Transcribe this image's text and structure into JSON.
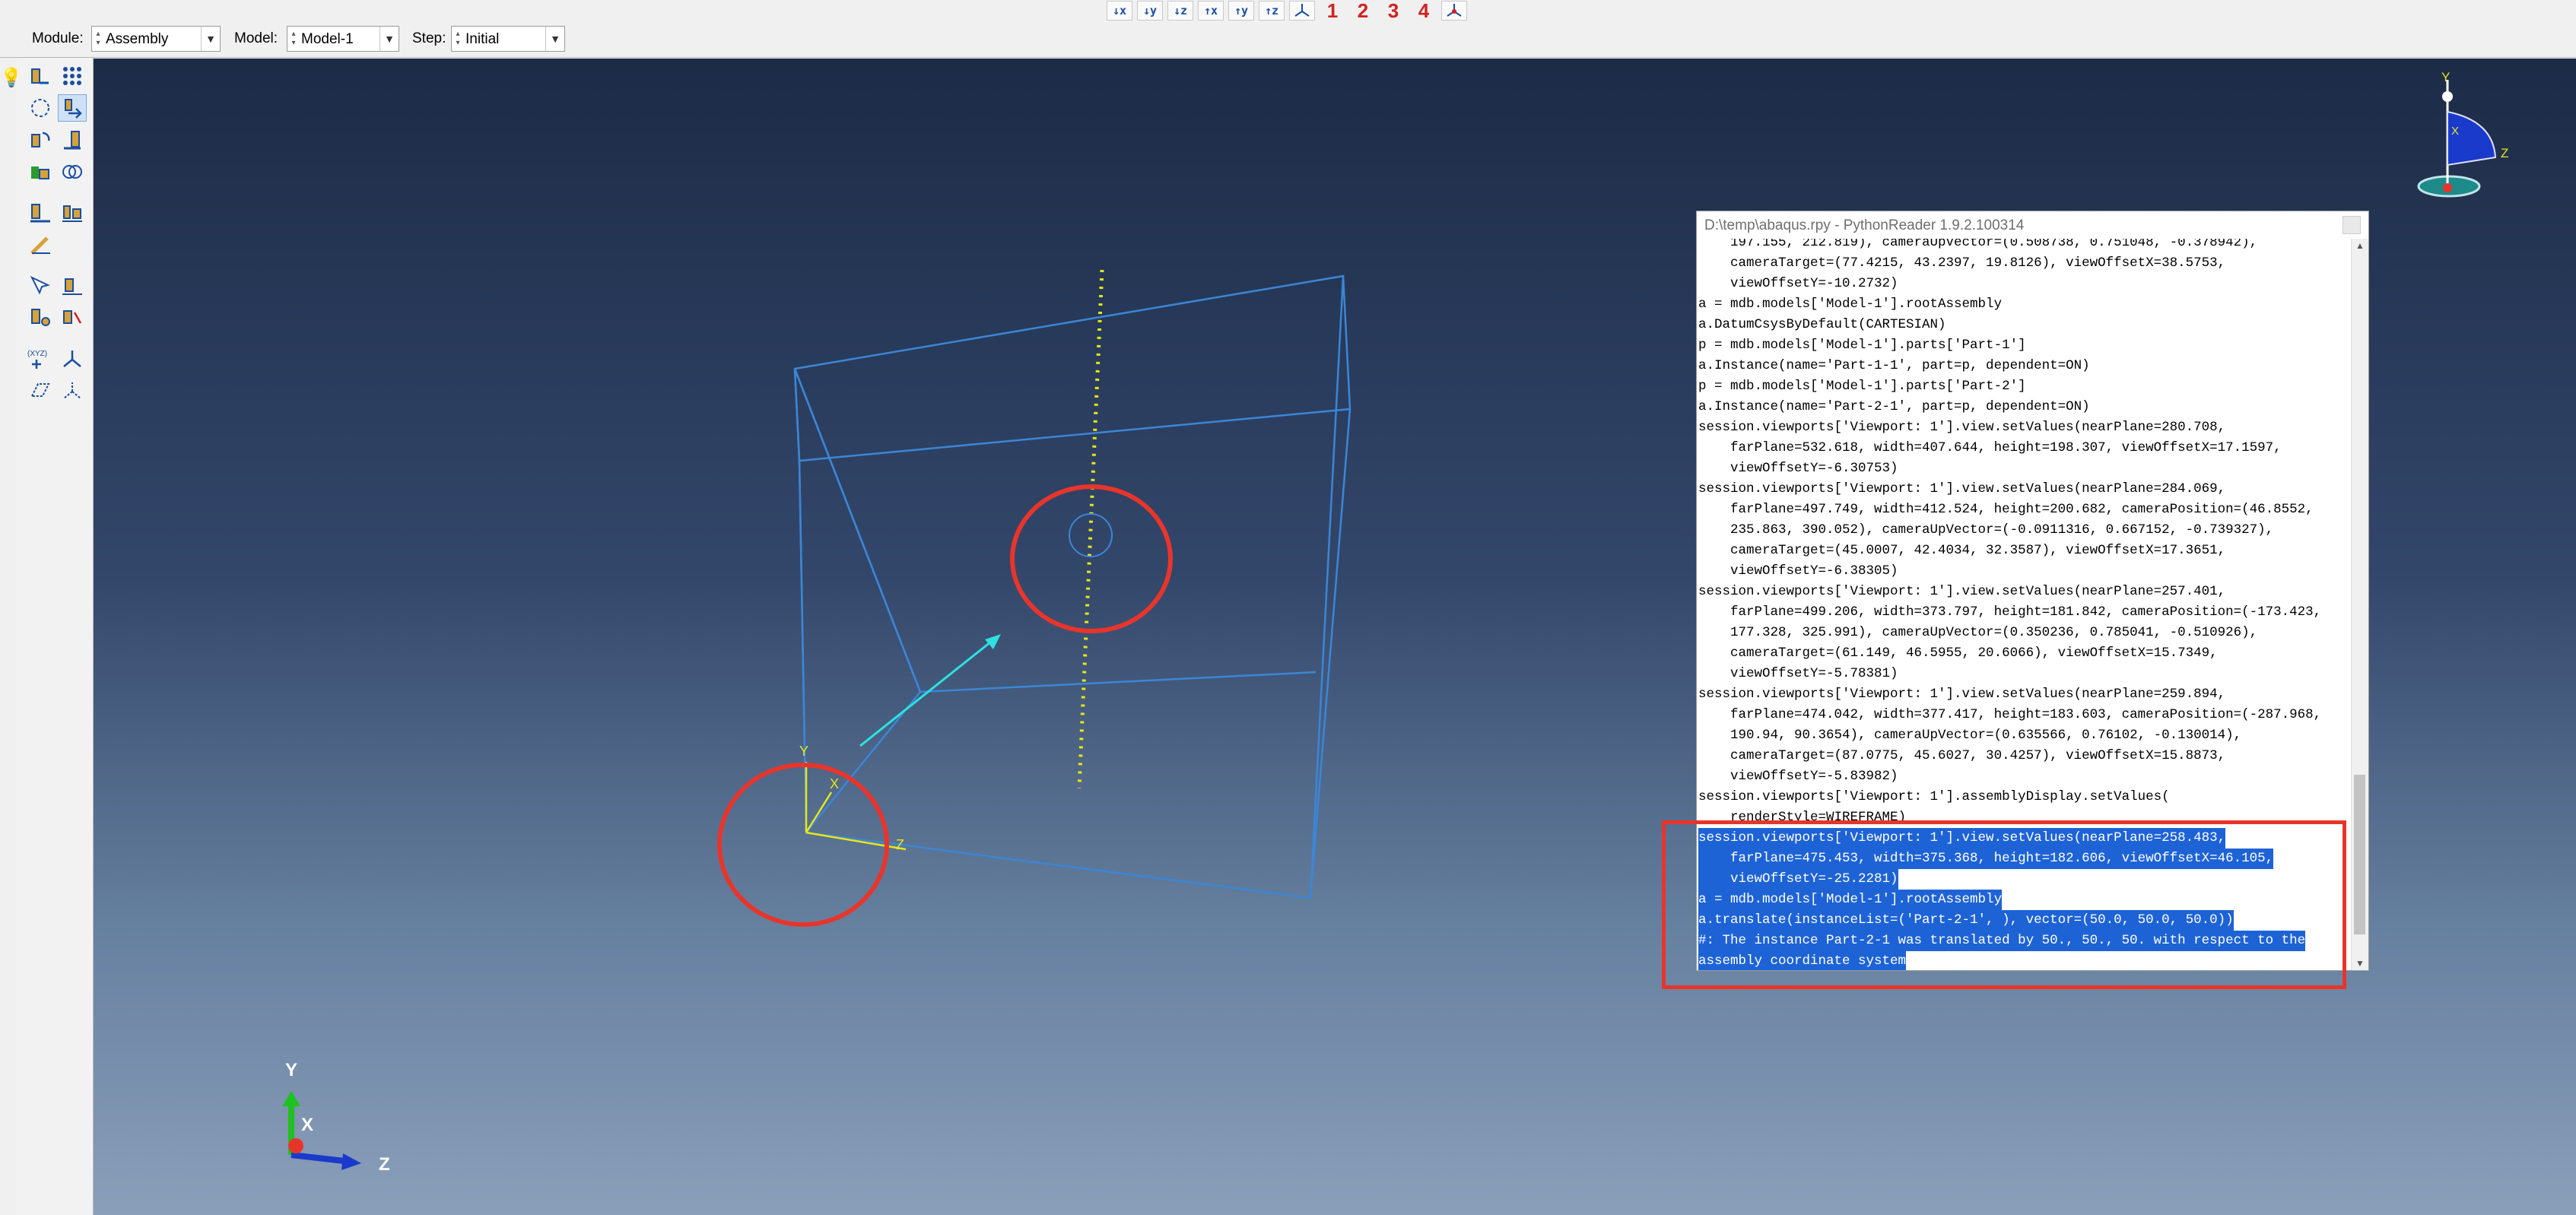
{
  "toolbar": {
    "view_buttons": [
      "↓x",
      "↓y",
      "↓z",
      "↑x",
      "↑y",
      "↑z"
    ],
    "view_numbers": [
      "1",
      "2",
      "3",
      "4"
    ]
  },
  "context_bar": {
    "module_label": "Module:",
    "module_value": "Assembly",
    "model_label": "Model:",
    "model_value": "Model-1",
    "step_label": "Step:",
    "step_value": "Initial"
  },
  "toolbox": {
    "xyz_label": "(XYZ)"
  },
  "viewport": {
    "triad": {
      "y": "Y",
      "x": "X",
      "z": "Z"
    },
    "assembly_csys": {
      "y": "Y",
      "x": "X",
      "z": "Z"
    },
    "compass": {
      "y": "Y",
      "x": "X",
      "z": "Z"
    }
  },
  "python_reader": {
    "title": "D:\\temp\\abaqus.rpy - PythonReader 1.9.2.100314",
    "lines": [
      "    197.155, 212.819), cameraUpVector=(0.508738, 0.751048, -0.378942),",
      "    cameraTarget=(77.4215, 43.2397, 19.8126), viewOffsetX=38.5753,",
      "    viewOffsetY=-10.2732)",
      "a = mdb.models['Model-1'].rootAssembly",
      "a.DatumCsysByDefault(CARTESIAN)",
      "p = mdb.models['Model-1'].parts['Part-1']",
      "a.Instance(name='Part-1-1', part=p, dependent=ON)",
      "p = mdb.models['Model-1'].parts['Part-2']",
      "a.Instance(name='Part-2-1', part=p, dependent=ON)",
      "session.viewports['Viewport: 1'].view.setValues(nearPlane=280.708,",
      "    farPlane=532.618, width=407.644, height=198.307, viewOffsetX=17.1597,",
      "    viewOffsetY=-6.30753)",
      "session.viewports['Viewport: 1'].view.setValues(nearPlane=284.069,",
      "    farPlane=497.749, width=412.524, height=200.682, cameraPosition=(46.8552,",
      "    235.863, 390.052), cameraUpVector=(-0.0911316, 0.667152, -0.739327),",
      "    cameraTarget=(45.0007, 42.4034, 32.3587), viewOffsetX=17.3651,",
      "    viewOffsetY=-6.38305)",
      "session.viewports['Viewport: 1'].view.setValues(nearPlane=257.401,",
      "    farPlane=499.206, width=373.797, height=181.842, cameraPosition=(-173.423,",
      "    177.328, 325.991), cameraUpVector=(0.350236, 0.785041, -0.510926),",
      "    cameraTarget=(61.149, 46.5955, 20.6066), viewOffsetX=15.7349,",
      "    viewOffsetY=-5.78381)",
      "session.viewports['Viewport: 1'].view.setValues(nearPlane=259.894,",
      "    farPlane=474.042, width=377.417, height=183.603, cameraPosition=(-287.968,",
      "    190.94, 90.3654), cameraUpVector=(0.635566, 0.76102, -0.130014),",
      "    cameraTarget=(87.0775, 45.6027, 30.4257), viewOffsetX=15.8873,",
      "    viewOffsetY=-5.83982)",
      "session.viewports['Viewport: 1'].assemblyDisplay.setValues(",
      "    renderStyle=WIREFRAME)",
      "session.viewports['Viewport: 1'].view.setValues(nearPlane=258.483,",
      "    farPlane=475.453, width=375.368, height=182.606, viewOffsetX=46.105,",
      "    viewOffsetY=-25.2281)",
      "a = mdb.models['Model-1'].rootAssembly",
      "a.translate(instanceList=('Part-2-1', ), vector=(50.0, 50.0, 50.0))",
      "#: The instance Part-2-1 was translated by 50., 50., 50. with respect to the",
      "assembly coordinate system"
    ],
    "selected_from_index": 29
  },
  "colors": {
    "wireframe": "#3b86d6",
    "selection_highlight": "#1e63d6",
    "annotation_red": "#e8352b",
    "translate_arrow": "#2ee0e0",
    "yellow_axis": "#e6e61a"
  }
}
